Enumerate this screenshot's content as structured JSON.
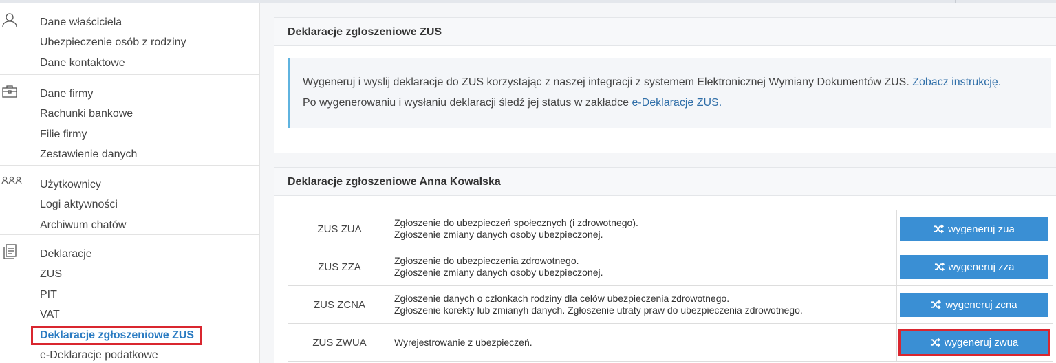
{
  "sidebar": {
    "groups": [
      {
        "icon": "user-icon",
        "items": [
          "Dane właściciela",
          "Ubezpieczenie osób z rodziny",
          "Dane kontaktowe"
        ]
      },
      {
        "icon": "briefcase-icon",
        "items": [
          "Dane firmy",
          "Rachunki bankowe",
          "Filie firmy",
          "Zestawienie danych"
        ]
      },
      {
        "icon": "users-icon",
        "items": [
          "Użytkownicy",
          "Logi aktywności",
          "Archiwum chatów"
        ]
      },
      {
        "icon": "documents-icon",
        "items": [
          "Deklaracje",
          "ZUS",
          "PIT",
          "VAT",
          "Deklaracje zgłoszeniowe ZUS",
          "e-Deklaracje podatkowe"
        ]
      }
    ]
  },
  "panel1": {
    "title": "Deklaracje zgloszeniowe ZUS",
    "line1": "Wygeneruj i wyslij deklaracje do ZUS korzystając z naszej integracji z systemem Elektronicznej Wymiany Dokumentów ZUS.",
    "line1_link": "Zobacz instrukcję.",
    "line2": "Po wygenerowaniu i wysłaniu deklaracji śledź jej status w zakładce",
    "line2_link": "e-Deklaracje ZUS."
  },
  "panel2": {
    "title": "Deklaracje zgłoszeniowe Anna Kowalska",
    "rows": [
      {
        "code": "ZUS ZUA",
        "desc1": "Zgłoszenie do ubezpieczeń społecznych (i zdrowotnego).",
        "desc2": "Zgłoszenie zmiany danych osoby ubezpieczonej.",
        "button": "wygeneruj zua"
      },
      {
        "code": "ZUS ZZA",
        "desc1": "Zgłoszenie do ubezpieczenia zdrowotnego.",
        "desc2": "Zgłoszenie zmiany danych osoby ubezpieczonej.",
        "button": "wygeneruj zza"
      },
      {
        "code": "ZUS ZCNA",
        "desc1": "Zgłoszenie danych o członkach rodziny dla celów ubezpieczenia zdrowotnego.",
        "desc2": "Zgłoszenie korekty lub zmianyh danych. Zgłoszenie utraty praw do ubezpieczenia zdrowotnego.",
        "button": "wygeneruj zcna"
      },
      {
        "code": "ZUS ZWUA",
        "desc1": "Wyrejestrowanie z ubezpieczeń.",
        "desc2": "",
        "button": "wygeneruj zwua"
      }
    ]
  },
  "colors": {
    "accent": "#3a8fd4",
    "link": "#2f6ea8",
    "highlight": "#d9262f",
    "active": "#2a7bc2"
  }
}
